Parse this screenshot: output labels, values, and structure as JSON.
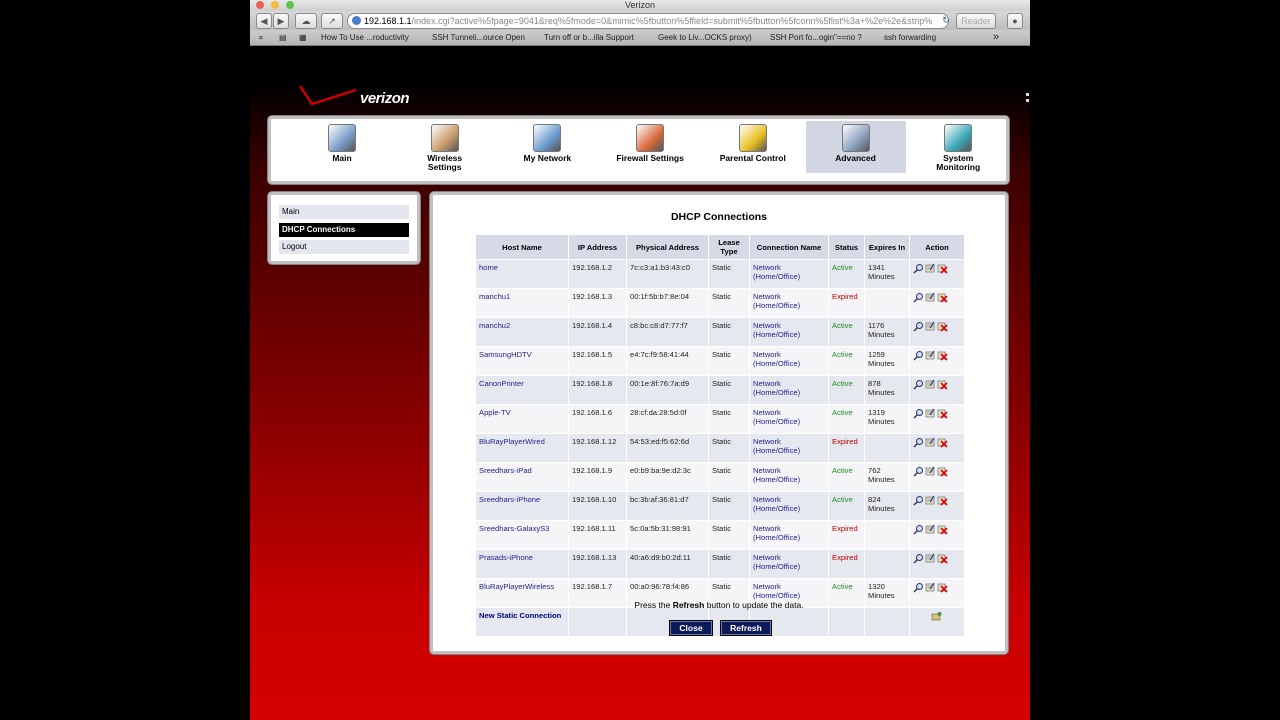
{
  "window": {
    "title": "Verizon"
  },
  "toolbar": {
    "url_host": "192.168.1.1",
    "url_path": "/index.cgi?active%5fpage=9041&req%5fmode=0&mimic%5fbutton%5ffield=submit%5fbutton%5fconn%5flist%3a+%2e%2e&strip%",
    "reader_label": "Reader"
  },
  "bookmarks": [
    "How To Use ...roductivity",
    "SSH Tunneli...ource Open",
    "Turn off or b...illa Support",
    "Geek to Liv...OCKS proxy)",
    "SSH Port fo...ogin\"==no ?",
    "ssh forwarding"
  ],
  "brand": {
    "logo_text": "verizon"
  },
  "nav": [
    {
      "label": "Main",
      "icon": "main-icon",
      "color": "#7a9cc8"
    },
    {
      "label": "Wireless Settings",
      "icon": "wireless-icon",
      "color": "#c89a6a"
    },
    {
      "label": "My Network",
      "icon": "network-icon",
      "color": "#6a9ad0"
    },
    {
      "label": "Firewall Settings",
      "icon": "firewall-icon",
      "color": "#d86a3a"
    },
    {
      "label": "Parental Control",
      "icon": "lock-icon",
      "color": "#e8c020"
    },
    {
      "label": "Advanced",
      "icon": "advanced-icon",
      "color": "#8aa0c0"
    },
    {
      "label": "System Monitoring",
      "icon": "monitor-icon",
      "color": "#3aa8b8"
    }
  ],
  "sidebar": {
    "items": [
      "Main",
      "DHCP Connections",
      "Logout"
    ]
  },
  "dhcp": {
    "title": "DHCP Connections",
    "columns": [
      "Host Name",
      "IP Address",
      "Physical Address",
      "Lease Type",
      "Connection Name",
      "Status",
      "Expires In",
      "Action"
    ],
    "rows": [
      {
        "host": "home",
        "ip": "192.168.1.2",
        "mac": "7c:c3:a1:b3:43:c0",
        "lease": "Static",
        "conn": "Network (Home/Office)",
        "status": "Active",
        "expires": "1341 Minutes"
      },
      {
        "host": "manchu1",
        "ip": "192.168.1.3",
        "mac": "00:1f:5b:b7:8e:04",
        "lease": "Static",
        "conn": "Network (Home/Office)",
        "status": "Expired",
        "expires": ""
      },
      {
        "host": "manchu2",
        "ip": "192.168.1.4",
        "mac": "c8:bc:c8:d7:77:f7",
        "lease": "Static",
        "conn": "Network (Home/Office)",
        "status": "Active",
        "expires": "1176 Minutes"
      },
      {
        "host": "SamsungHDTV",
        "ip": "192.168.1.5",
        "mac": "e4:7c:f9:58:41:44",
        "lease": "Static",
        "conn": "Network (Home/Office)",
        "status": "Active",
        "expires": "1259 Minutes"
      },
      {
        "host": "CanonPrinter",
        "ip": "192.168.1.8",
        "mac": "00:1e:8f:76:7a:d9",
        "lease": "Static",
        "conn": "Network (Home/Office)",
        "status": "Active",
        "expires": "878 Minutes"
      },
      {
        "host": "Apple-TV",
        "ip": "192.168.1.6",
        "mac": "28:cf:da:28:5d:0f",
        "lease": "Static",
        "conn": "Network (Home/Office)",
        "status": "Active",
        "expires": "1319 Minutes"
      },
      {
        "host": "BluRayPlayerWired",
        "ip": "192.168.1.12",
        "mac": "54:53:ed:f5:62:6d",
        "lease": "Static",
        "conn": "Network (Home/Office)",
        "status": "Expired",
        "expires": ""
      },
      {
        "host": "Sreedhars-iPad",
        "ip": "192.168.1.9",
        "mac": "e0:b9:ba:9e:d2:3c",
        "lease": "Static",
        "conn": "Network (Home/Office)",
        "status": "Active",
        "expires": "762 Minutes"
      },
      {
        "host": "Sreedhars-iPhone",
        "ip": "192.168.1.10",
        "mac": "bc:3b:af:36:81:d7",
        "lease": "Static",
        "conn": "Network (Home/Office)",
        "status": "Active",
        "expires": "824 Minutes"
      },
      {
        "host": "Sreedhars-GalaxyS3",
        "ip": "192.168.1.11",
        "mac": "5c:0a:5b:31:98:91",
        "lease": "Static",
        "conn": "Network (Home/Office)",
        "status": "Expired",
        "expires": ""
      },
      {
        "host": "Prasads-iPhone",
        "ip": "192.168.1.13",
        "mac": "40:a6:d9:b0:2d:11",
        "lease": "Static",
        "conn": "Network (Home/Office)",
        "status": "Expired",
        "expires": ""
      },
      {
        "host": "BluRayPlayerWireless",
        "ip": "192.168.1.7",
        "mac": "00:a0:96:78:f4:86",
        "lease": "Static",
        "conn": "Network (Home/Office)",
        "status": "Active",
        "expires": "1320 Minutes"
      }
    ],
    "new_static_label": "New Static Connection",
    "hint_before": "Press the ",
    "hint_bold": "Refresh",
    "hint_after": " button to update the data.",
    "close_label": "Close",
    "refresh_label": "Refresh"
  },
  "colors": {
    "active": "#1d8a1d",
    "expired": "#c00000",
    "button": "#0c1a5a"
  }
}
